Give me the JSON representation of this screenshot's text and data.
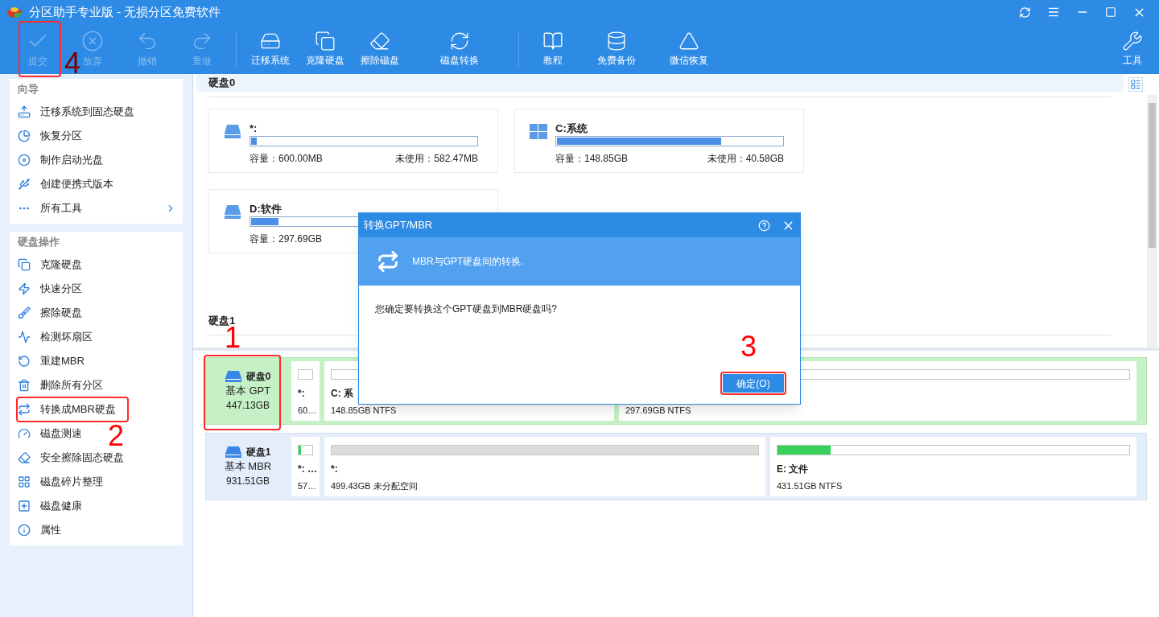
{
  "window": {
    "title": "分区助手专业版 - 无损分区免费软件"
  },
  "toolbar": {
    "groups": [
      [
        {
          "label": "提交",
          "disabled": true,
          "annotation": "4"
        },
        {
          "label": "放弃",
          "disabled": true
        },
        {
          "label": "撤销",
          "disabled": true
        },
        {
          "label": "重做",
          "disabled": true
        }
      ],
      [
        {
          "label": "迁移系统",
          "disabled": false
        },
        {
          "label": "克隆硬盘",
          "disabled": false
        },
        {
          "label": "擦除磁盘",
          "disabled": false
        },
        {
          "label": "磁盘转换",
          "disabled": false
        }
      ],
      [
        {
          "label": "教程",
          "disabled": false
        },
        {
          "label": "免费备份",
          "disabled": false
        },
        {
          "label": "微信恢复",
          "disabled": false
        }
      ]
    ],
    "right": {
      "label": "工具"
    }
  },
  "sidebar": {
    "sections": [
      {
        "title": "向导",
        "items": [
          {
            "label": "迁移系统到固态硬盘"
          },
          {
            "label": "恢复分区"
          },
          {
            "label": "制作启动光盘"
          },
          {
            "label": "创建便携式版本"
          },
          {
            "label": "所有工具",
            "expandable": true
          }
        ]
      },
      {
        "title": "硬盘操作",
        "items": [
          {
            "label": "克隆硬盘"
          },
          {
            "label": "快速分区"
          },
          {
            "label": "擦除硬盘"
          },
          {
            "label": "检测坏扇区"
          },
          {
            "label": "重建MBR"
          },
          {
            "label": "删除所有分区"
          },
          {
            "label": "转换成MBR硬盘",
            "annotation": "2"
          },
          {
            "label": "磁盘测速"
          },
          {
            "label": "安全擦除固态硬盘"
          },
          {
            "label": "磁盘碎片整理"
          },
          {
            "label": "磁盘健康"
          },
          {
            "label": "属性"
          }
        ]
      }
    ]
  },
  "partition_view": {
    "disks": [
      {
        "title": "硬盘0",
        "cards": [
          {
            "kind": "drive",
            "name": "*:",
            "level": 0.02,
            "capacity": "容量：600.00MB",
            "unused": "未使用：582.47MB"
          },
          {
            "kind": "windows",
            "name": "C:系统",
            "level": 0.73,
            "capacity": "容量：148.85GB",
            "unused": "未使用：40.58GB"
          },
          {
            "kind": "drive",
            "name": "D:软件",
            "level": 0.12,
            "capacity": "容量：297.69GB"
          }
        ]
      },
      {
        "title": "硬盘1"
      }
    ]
  },
  "disk_map": [
    {
      "name": "硬盘0",
      "type": "基本 GPT",
      "size": "447.13GB",
      "selected": true,
      "annotation": "1",
      "partitions": [
        {
          "kind": "used",
          "name": "*:",
          "info": "60…"
        },
        {
          "kind": "used",
          "name": "C: 系",
          "info": "148.85GB NTFS"
        },
        {
          "kind": "used",
          "info": "297.69GB NTFS"
        }
      ]
    },
    {
      "name": "硬盘1",
      "type": "基本 MBR",
      "size": "931.51GB",
      "selected": false,
      "partitions": [
        {
          "kind": "used",
          "name": "*: …",
          "info": "57…",
          "level": 0.2
        },
        {
          "kind": "unallocated",
          "name": "*:",
          "info": "499.43GB 未分配空间"
        },
        {
          "kind": "used",
          "name": "E: 文件",
          "info": "431.51GB NTFS",
          "level": 0.15
        }
      ]
    }
  ],
  "dialog": {
    "title": "转换GPT/MBR",
    "banner": "MBR与GPT硬盘间的转换.",
    "message": "您确定要转换这个GPT硬盘到MBR硬盘吗?",
    "button": {
      "label": "确定(O)",
      "annotation": "3"
    }
  }
}
